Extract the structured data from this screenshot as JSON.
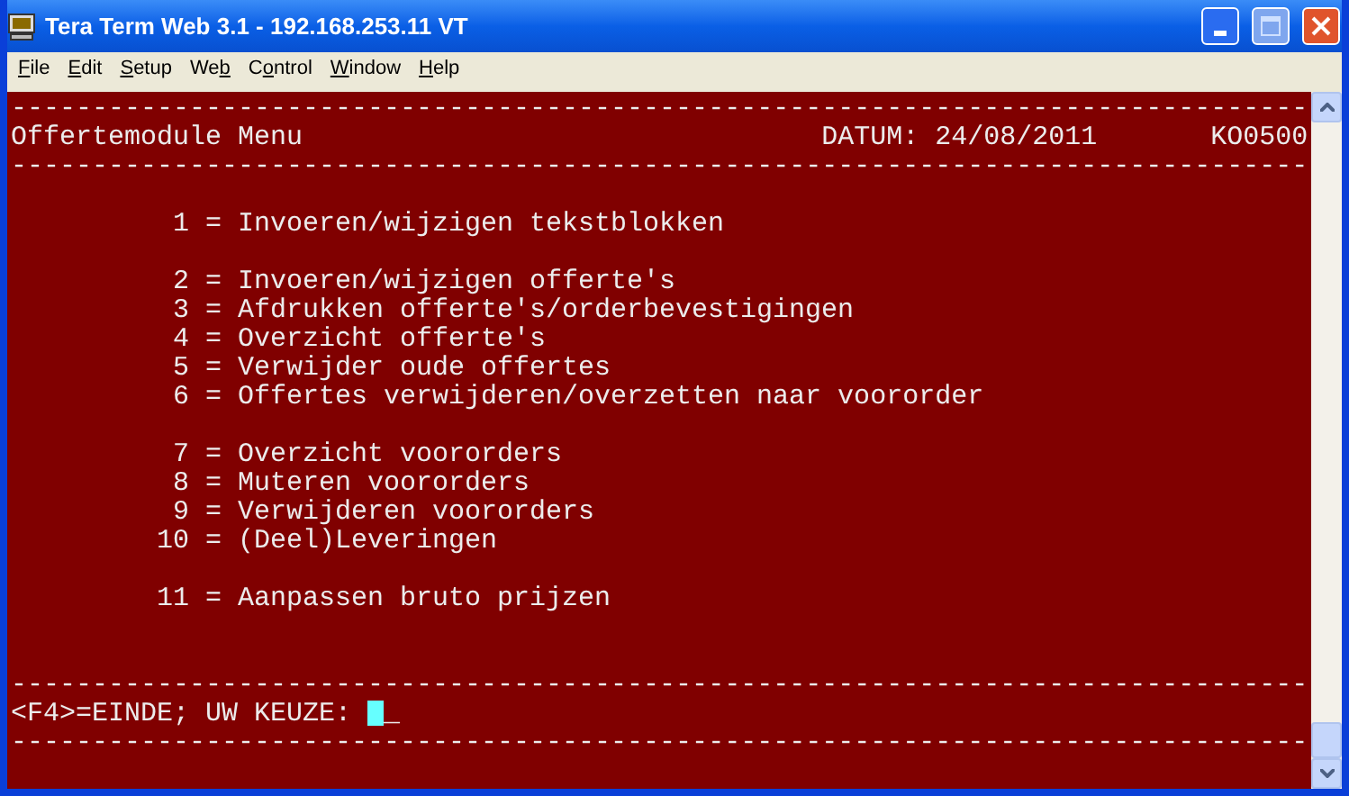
{
  "window": {
    "title": "Tera Term Web 3.1 - 192.168.253.11 VT"
  },
  "menu": [
    {
      "accel": "F",
      "rest": "ile"
    },
    {
      "accel": "E",
      "rest": "dit"
    },
    {
      "accel": "S",
      "rest": "etup"
    },
    {
      "pre": "We",
      "accel": "b"
    },
    {
      "pre": "C",
      "accel": "o",
      "rest": "ntrol"
    },
    {
      "accel": "W",
      "rest": "indow"
    },
    {
      "accel": "H",
      "rest": "elp"
    }
  ],
  "terminal": {
    "rows": [
      {
        "kind": "rule",
        "text": "--------------------------------------------------------------------------------"
      },
      {
        "kind": "header",
        "title": "Offertemodule Menu",
        "date": "DATUM: 24/08/2011",
        "code": "KO0500"
      },
      {
        "kind": "rule",
        "text": "--------------------------------------------------------------------------------"
      },
      {
        "kind": "blank"
      },
      {
        "kind": "item",
        "text": "1 = Invoeren/wijzigen tekstblokken"
      },
      {
        "kind": "blank"
      },
      {
        "kind": "item",
        "text": "2 = Invoeren/wijzigen offerte's"
      },
      {
        "kind": "item",
        "text": "3 = Afdrukken offerte's/orderbevestigingen"
      },
      {
        "kind": "item",
        "text": "4 = Overzicht offerte's"
      },
      {
        "kind": "item",
        "text": "5 = Verwijder oude offertes"
      },
      {
        "kind": "item",
        "text": "6 = Offertes verwijderen/overzetten naar voororder"
      },
      {
        "kind": "blank"
      },
      {
        "kind": "item",
        "text": "7 = Overzicht voororders"
      },
      {
        "kind": "item",
        "text": "8 = Muteren voororders"
      },
      {
        "kind": "item",
        "text": "9 = Verwijderen voororders"
      },
      {
        "kind": "item",
        "text": "10 = (Deel)Leveringen"
      },
      {
        "kind": "blank"
      },
      {
        "kind": "item",
        "text": "11 = Aanpassen bruto prijzen"
      },
      {
        "kind": "blank"
      },
      {
        "kind": "blank"
      },
      {
        "kind": "rule",
        "text": "--------------------------------------------------------------------------------"
      },
      {
        "kind": "prompt",
        "text": "<F4>=EINDE; UW KEUZE:",
        "field": "_"
      },
      {
        "kind": "rule",
        "text": "--------------------------------------------------------------------------------"
      }
    ]
  }
}
